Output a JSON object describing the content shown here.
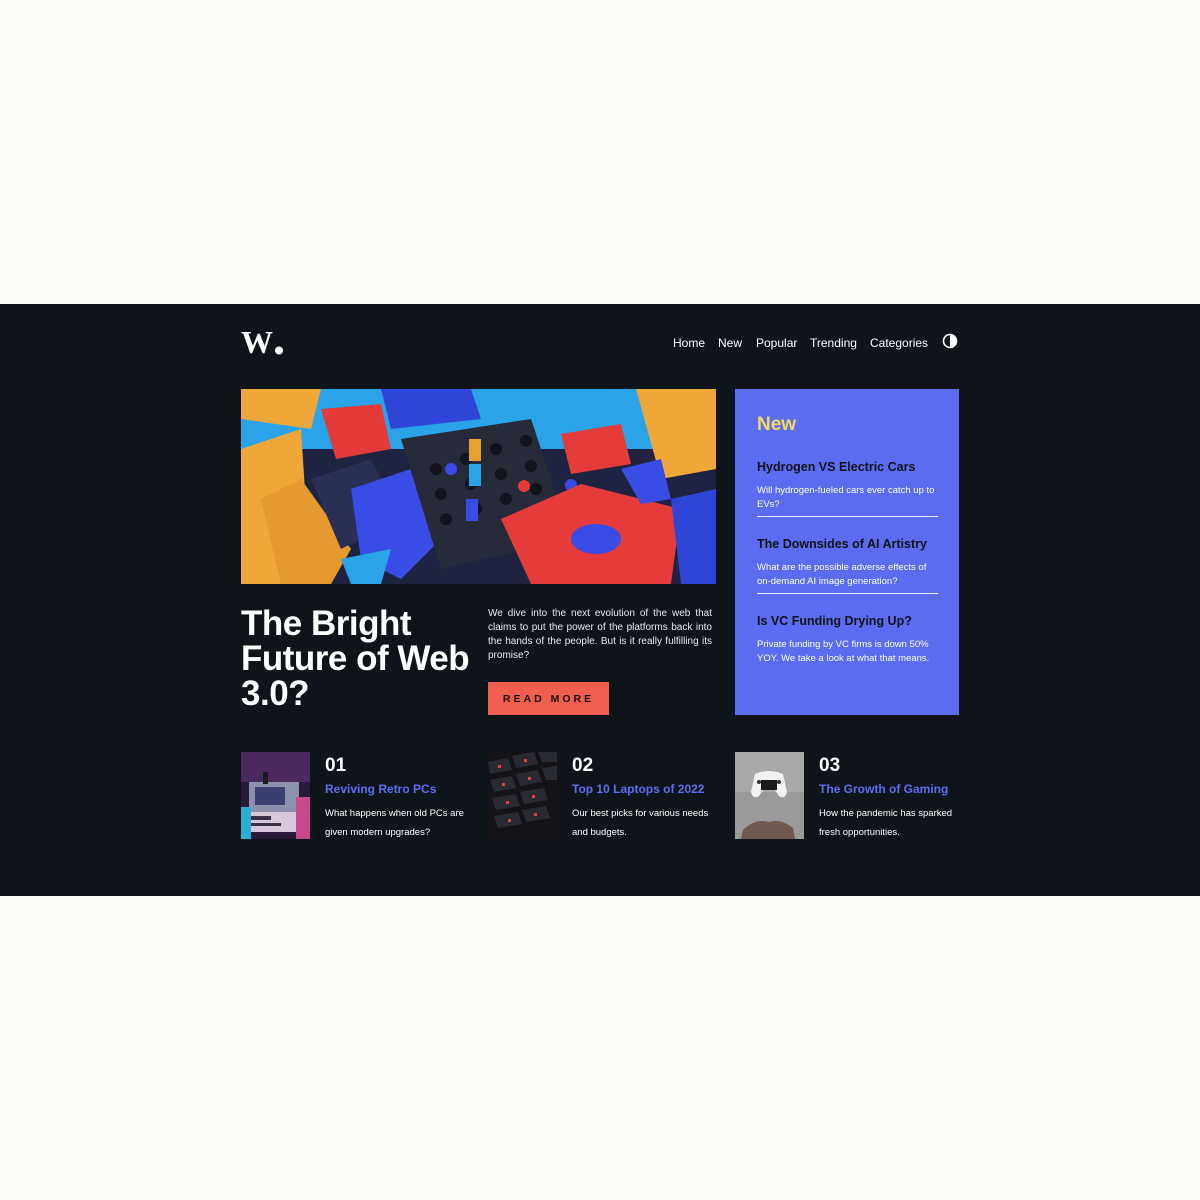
{
  "brand": {
    "logo_alt": "W."
  },
  "nav": {
    "links": [
      "Home",
      "New",
      "Popular",
      "Trending",
      "Categories"
    ],
    "theme_icon": "contrast-icon"
  },
  "hero": {
    "title": "The Bright Future of Web 3.0?",
    "description": "We dive into the next evolution of the web that claims to put the power of the platforms back into the hands of the people. But is it really fulfilling its promise?",
    "button_label": "READ MORE",
    "image_icon": "abstract-blocks-image"
  },
  "new_panel": {
    "heading": "New",
    "items": [
      {
        "title": "Hydrogen VS Electric Cars",
        "description": "Will hydrogen-fueled cars ever catch up to EVs?"
      },
      {
        "title": "The Downsides of AI Artistry",
        "description": "What are the possible adverse effects of on-demand AI image generation?"
      },
      {
        "title": "Is VC Funding Drying Up?",
        "description": "Private funding by VC firms is down 50% YOY. We take a look at what that means."
      }
    ]
  },
  "articles": [
    {
      "number": "01",
      "title": "Reviving Retro PCs",
      "description": "What happens when old PCs are given modern upgrades?",
      "thumb_icon": "retro-pc-image"
    },
    {
      "number": "02",
      "title": "Top 10 Laptops of 2022",
      "description": "Our best picks for various needs and budgets.",
      "thumb_icon": "keyboard-image"
    },
    {
      "number": "03",
      "title": "The Growth of Gaming",
      "description": "How the pandemic has sparked fresh opportunities.",
      "thumb_icon": "gamepad-image"
    }
  ],
  "colors": {
    "background": "#fdfcf8",
    "frame": "#0f141b",
    "accent_red": "#f15e50",
    "panel_blue": "#5c6cf0",
    "panel_heading_yellow": "#f5da5c",
    "link_blue": "#5b6ff0"
  }
}
